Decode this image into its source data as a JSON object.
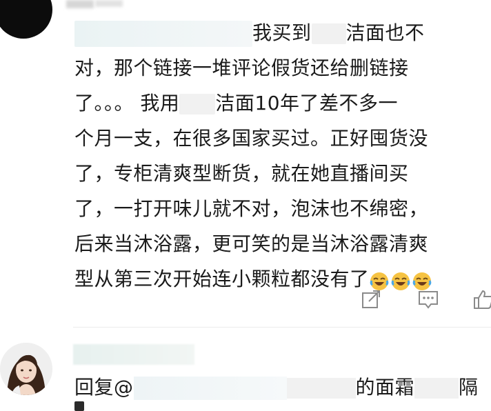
{
  "comment": {
    "lines": [
      {
        "before": "",
        "after": "我买到",
        "tail": "洁面也不"
      },
      {
        "text": "对，那个链接一堆评论假货还给删链接"
      },
      {
        "before": "了。。。 我用",
        "after": "洁面10年了差不多一"
      },
      {
        "text": "个月一支，在很多国家买过。正好囤货没"
      },
      {
        "text": "了，专柜清爽型断货，就在她直播间买"
      },
      {
        "text": "了，一打开味儿就不对，泡沫也不绵密，"
      },
      {
        "text": "后来当沐浴露，更可笑的是当沐浴露清爽"
      },
      {
        "text": "型从第三次开始连小颗粒都没有了"
      }
    ],
    "emoji": [
      "laughing-tears",
      "laughing-tears",
      "laughing-tears"
    ]
  },
  "actions": [
    {
      "name": "share-icon"
    },
    {
      "name": "comment-icon"
    },
    {
      "name": "like-icon"
    }
  ],
  "reply": {
    "prefix": "回复@",
    "middle": "的面霜",
    "suffix": "隔"
  },
  "colors": {
    "text": "#1a1a1a",
    "icon": "#8a8a8a",
    "emoji": "#f6c343"
  }
}
